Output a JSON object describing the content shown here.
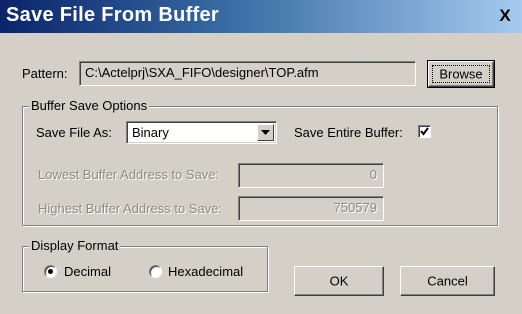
{
  "window": {
    "title": "Save File From Buffer",
    "close_glyph": "X",
    "title_gradient": [
      "#0a246a",
      "#a6caf0"
    ]
  },
  "pattern": {
    "label": "Pattern:",
    "value": "C:\\Actelprj\\SXA_FIFO\\designer\\TOP.afm",
    "browse_label": "Browse"
  },
  "buffer_save_options": {
    "legend": "Buffer Save Options",
    "save_file_as_label": "Save File As:",
    "save_file_as_value": "Binary",
    "save_entire_buffer_label": "Save Entire Buffer:",
    "save_entire_buffer_checked": true,
    "lowest_label": "Lowest Buffer Address to Save:",
    "lowest_value": "0",
    "highest_label": "Highest Buffer Address to Save:",
    "highest_value": "750579"
  },
  "display_format": {
    "legend": "Display Format",
    "options": [
      {
        "label": "Decimal",
        "selected": true
      },
      {
        "label": "Hexadecimal",
        "selected": false
      }
    ]
  },
  "buttons": {
    "ok_label": "OK",
    "cancel_label": "Cancel"
  }
}
